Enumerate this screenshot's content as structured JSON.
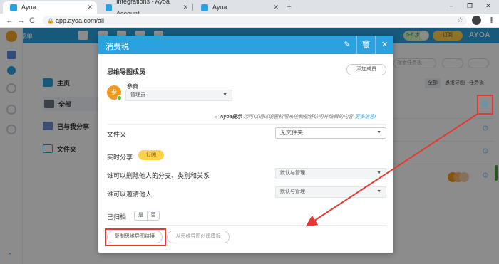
{
  "browser": {
    "tabs": [
      {
        "title": "Ayoa",
        "active": true
      },
      {
        "title": "Integrations - Ayoa Account",
        "active": false
      },
      {
        "title": "Ayoa",
        "active": false
      }
    ],
    "url": "app.ayoa.com/all",
    "new_tab": "+",
    "tab_close": "✕",
    "window_controls": [
      "–",
      "❐",
      "✕"
    ],
    "nav": {
      "back": "←",
      "forward": "→",
      "reload": "C"
    }
  },
  "app_header": {
    "menu_label": "菜单",
    "toggle_label": "5-6 步",
    "subscribe_label": "订阅",
    "logo": "AYOA",
    "brand_color": "#2aa2e0"
  },
  "sidebar": {
    "items": [
      {
        "label": "主页",
        "icon": "home-icon"
      },
      {
        "label": "全部",
        "icon": "folder-stack-icon",
        "active": true
      },
      {
        "label": "已与我分享",
        "icon": "users-icon"
      },
      {
        "label": "文件夹",
        "icon": "folder-icon"
      }
    ]
  },
  "content": {
    "search_placeholder": "搜索任务板",
    "view_tabs": [
      "全部",
      "思维导图",
      "任务板"
    ]
  },
  "dialog": {
    "title": "消费税",
    "members_title": "思维导图成员",
    "add_member_label": "添加成员",
    "member": {
      "avatar_text": "参",
      "name": "参商",
      "role": "管理员"
    },
    "tip_prefix": "Ayoa提示",
    "tip_text": "您可以通过设置权限来控制能够访问并编辑的内容",
    "tip_more": "更多信息!",
    "folder_label": "文件夹",
    "folder_value": "无文件夹",
    "live_share_label": "实时分享",
    "live_share_button": "订阅",
    "delete_perm_label": "谁可以删除他人的分支、类别和关系",
    "delete_perm_value": "默认与管理",
    "invite_perm_label": "谁可以邀请他人",
    "invite_perm_value": "默认与管理",
    "archived_label": "已归档",
    "archived_options": [
      "是",
      "否"
    ],
    "copy_link_label": "复制思维导图链接",
    "template_label": "从思维导图创建模板",
    "accent_color": "#2aa2e0"
  },
  "annotation_color": "#e53935"
}
